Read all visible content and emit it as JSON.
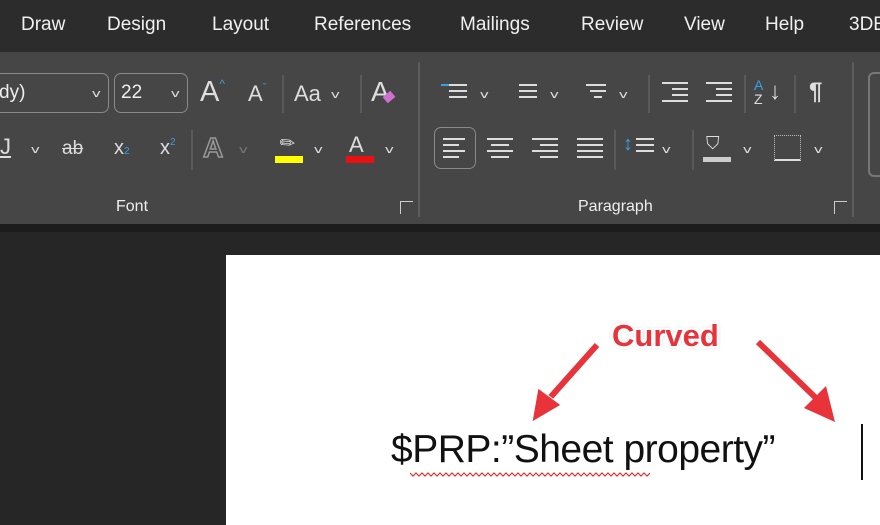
{
  "menu": {
    "items": [
      "Draw",
      "Design",
      "Layout",
      "References",
      "Mailings",
      "Review",
      "View",
      "Help",
      "3DE"
    ]
  },
  "font_group": {
    "font_name": "dy)",
    "font_size": "22",
    "grow_label": "A",
    "shrink_label": "A",
    "case_label": "Aa",
    "sub_label": "x",
    "sub_digit": "2",
    "sup_label": "x",
    "sup_digit": "2",
    "strike_label": "ab",
    "label": "Font",
    "highlight_color": "#ffff00",
    "font_color": "#e81010"
  },
  "paragraph_group": {
    "label": "Paragraph",
    "pilcrow": "¶",
    "sort_a": "A",
    "sort_z": "Z"
  },
  "document": {
    "text": "$PRP:”Sheet property”"
  },
  "annotation": {
    "label": "Curved",
    "color": "#e8333a"
  }
}
